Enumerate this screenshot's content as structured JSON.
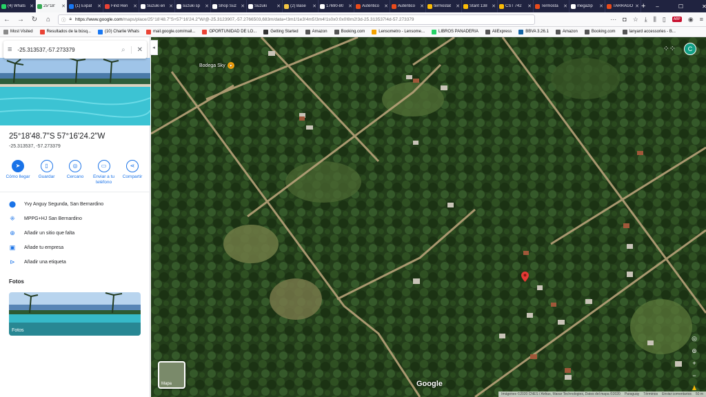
{
  "tabs": [
    {
      "title": "(4) Whats",
      "color": "#25d366",
      "active": false
    },
    {
      "title": "25°18'",
      "color": "#34a853",
      "active": true
    },
    {
      "title": "(1) Expat",
      "color": "#1877f2",
      "active": false
    },
    {
      "title": "Find Ren",
      "color": "#e94235",
      "active": false
    },
    {
      "title": "Suzuki en",
      "color": "#ffffff",
      "active": false
    },
    {
      "title": "suzuki sp",
      "color": "#ffffff",
      "active": false
    },
    {
      "title": "Shop Suz",
      "color": "#ffffff",
      "active": false
    },
    {
      "title": "Suzuki",
      "color": "#ffffff",
      "active": false
    },
    {
      "title": "(2) Base",
      "color": "#f4c542",
      "active": false
    },
    {
      "title": "17690-80",
      "color": "#ffffff",
      "active": false
    },
    {
      "title": "Auténtico",
      "color": "#e94b1b",
      "active": false
    },
    {
      "title": "Auténtico",
      "color": "#e94b1b",
      "active": false
    },
    {
      "title": "termostat",
      "color": "#fbbc05",
      "active": false
    },
    {
      "title": "Stant 138",
      "color": "#fbbc05",
      "active": false
    },
    {
      "title": "CST 742",
      "color": "#fbbc05",
      "active": false
    },
    {
      "title": "Termosta",
      "color": "#e94b1b",
      "active": false
    },
    {
      "title": "megazip",
      "color": "#ffffff",
      "active": false
    },
    {
      "title": "TARRAGO",
      "color": "#e94b1b",
      "active": false
    }
  ],
  "browser": {
    "url_domain": "https://www.google.com",
    "url_rest": "/maps/place/25°18'48.7\"S+57°16'24.2\"W/@-25.3123907,-57.2766503,683m/data=!3m1!1e3!4m5!3m4!1s0x0:0x0!8m2!3d-25.313537!4d-57.273379",
    "bookmarks": [
      {
        "label": "Most Visited",
        "color": "#8a8a8a"
      },
      {
        "label": "Resultados de la búsq...",
        "color": "#ea4335"
      },
      {
        "label": "(10) Charlie Whats",
        "color": "#1877f2"
      },
      {
        "label": "mail.google.com/mail...",
        "color": "#ea4335"
      },
      {
        "label": "OPORTUNIDAD DE LO...",
        "color": "#ea4335"
      },
      {
        "label": "Getting Started",
        "color": "#333333"
      },
      {
        "label": "Amazon",
        "color": "#555555"
      },
      {
        "label": "Booking.com",
        "color": "#555555"
      },
      {
        "label": "Lensometro - Lensome...",
        "color": "#f4a300"
      },
      {
        "label": "LIBROS PANADERIA",
        "color": "#25d366"
      },
      {
        "label": "AliExpress",
        "color": "#555555"
      },
      {
        "label": "BBVA 3.26.1",
        "color": "#1464a5"
      },
      {
        "label": "Amazon",
        "color": "#555555"
      },
      {
        "label": "Booking.com",
        "color": "#555555"
      },
      {
        "label": "lanyard accessories - B...",
        "color": "#555555"
      }
    ]
  },
  "search": {
    "value": "-25.313537,-57.273379"
  },
  "place": {
    "title": "25°18'48.7\"S 57°16'24.2\"W",
    "coords": "-25.313537, -57.273379"
  },
  "actions": [
    {
      "label": "Cómo llegar",
      "icon": "directions-icon"
    },
    {
      "label": "Guardar",
      "icon": "bookmark-icon"
    },
    {
      "label": "Cercano",
      "icon": "nearby-icon"
    },
    {
      "label": "Enviar a tu teléfono",
      "icon": "send-to-phone-icon"
    },
    {
      "label": "Compartir",
      "icon": "share-icon"
    }
  ],
  "info": [
    {
      "label": "Yvy Anguy Segunda, San Bernardino",
      "icon": "location-pin-icon"
    },
    {
      "label": "MPPG+HJ San Bernardino",
      "icon": "plus-code-icon"
    },
    {
      "label": "Añadir un sitio que falta",
      "icon": "add-place-icon"
    },
    {
      "label": "Añade tu empresa",
      "icon": "add-business-icon"
    },
    {
      "label": "Añadir una etiqueta",
      "icon": "label-icon"
    }
  ],
  "photos": {
    "heading": "Fotos",
    "card_label": "Fotos"
  },
  "map": {
    "poi_label": "Bodega Sky",
    "google_logo": "Google",
    "layers_label": "Mapa",
    "avatar_letter": "C",
    "attribution": [
      "Imágenes ©2020 CNES / Airbus, Maxar Technologies, Datos del mapa ©2020",
      "Paraguay",
      "Términos",
      "Enviar comentarios",
      "50 m"
    ]
  }
}
